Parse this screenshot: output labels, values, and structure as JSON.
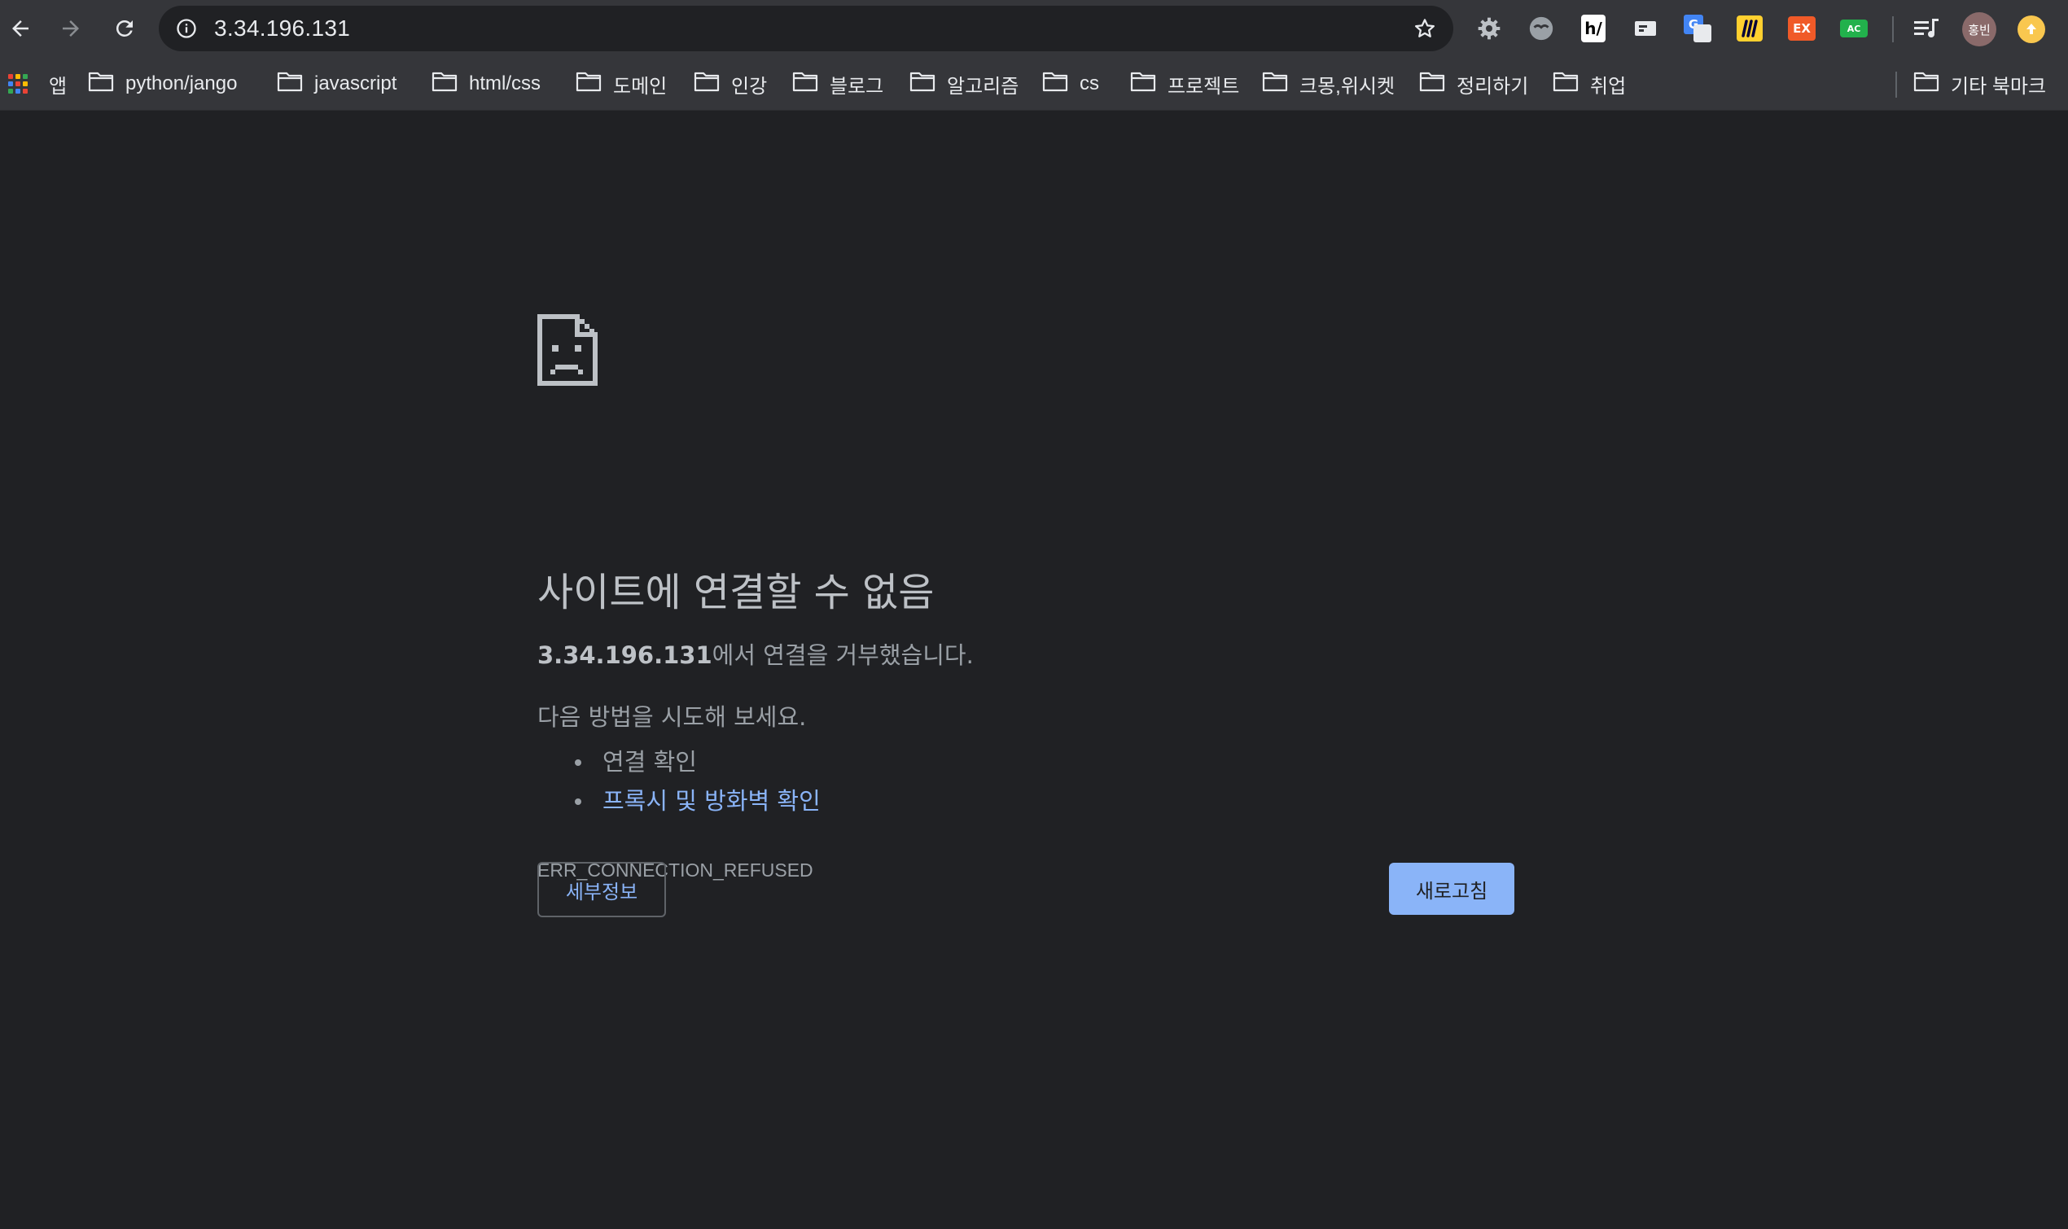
{
  "browser": {
    "address_bar": {
      "url": "3.34.196.131"
    },
    "profile": {
      "avatar_text": "홍빈"
    },
    "extensions": [
      {
        "name": "gear-extension-icon",
        "label": ""
      },
      {
        "name": "face-extension-icon",
        "label": ""
      },
      {
        "name": "h-extension-icon",
        "label": "h/"
      },
      {
        "name": "screen-extension-icon",
        "label": ""
      },
      {
        "name": "google-translate-icon",
        "label": "G"
      },
      {
        "name": "miro-icon",
        "label": "M"
      },
      {
        "name": "ex-extension-icon",
        "label": "EX"
      },
      {
        "name": "ac-extension-icon",
        "label": "AC"
      }
    ],
    "colors": {
      "toolbar": "#35363a",
      "page_bg": "#202124",
      "link": "#8ab4f8",
      "primary_button": "#8ab4f8"
    }
  },
  "bookmarks": {
    "apps_label": "앱",
    "folders": [
      "python/jango",
      "javascript",
      "html/css",
      "도메인",
      "인강",
      "블로그",
      "알고리즘",
      "cs",
      "프로젝트",
      "크몽,위시켓",
      "정리하기",
      "취업"
    ],
    "other_label": "기타 북마크"
  },
  "error_page": {
    "title": "사이트에 연결할 수 없음",
    "host": "3.34.196.131",
    "message_suffix": "에서 연결을 거부했습니다.",
    "suggestions_title": "다음 방법을 시도해 보세요.",
    "suggestions": [
      {
        "text": "연결 확인",
        "is_link": false
      },
      {
        "text": "프록시 및 방화벽 확인",
        "is_link": true
      }
    ],
    "error_code": "ERR_CONNECTION_REFUSED",
    "details_button": "세부정보",
    "reload_button": "새로고침"
  }
}
